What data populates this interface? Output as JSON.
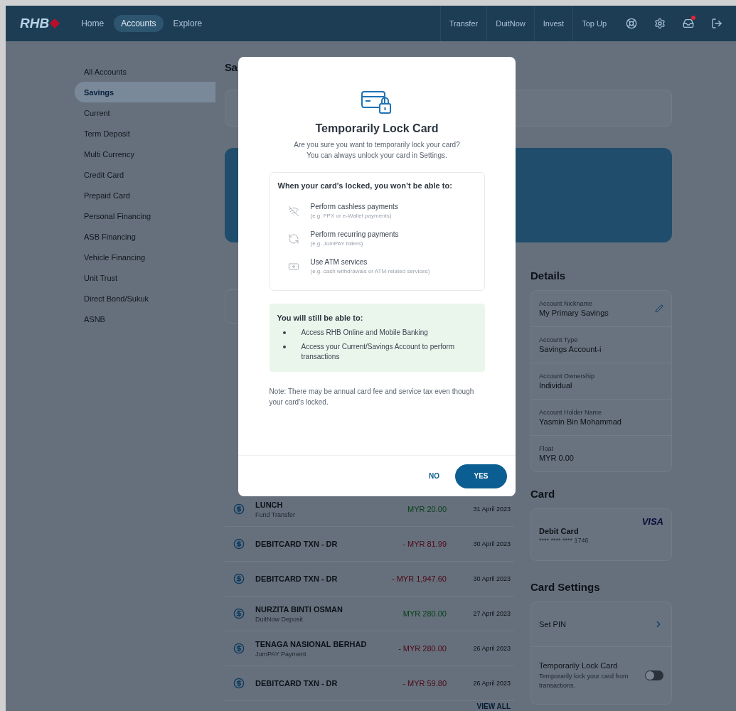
{
  "nav": {
    "logo": "RHB",
    "tabs": [
      {
        "label": "Home",
        "selected": false
      },
      {
        "label": "Accounts",
        "selected": true
      },
      {
        "label": "Explore",
        "selected": false
      }
    ],
    "actions": [
      "Transfer",
      "DuitNow",
      "Invest",
      "Top Up"
    ],
    "inbox_unread": true
  },
  "sidebar": {
    "items": [
      {
        "label": "All Accounts",
        "selected": false
      },
      {
        "label": "Savings",
        "selected": true
      },
      {
        "label": "Current",
        "selected": false
      },
      {
        "label": "Term Deposit",
        "selected": false
      },
      {
        "label": "Multi Currency",
        "selected": false
      },
      {
        "label": "Credit Card",
        "selected": false
      },
      {
        "label": "Prepaid Card",
        "selected": false
      },
      {
        "label": "Personal Financing",
        "selected": false
      },
      {
        "label": "ASB Financing",
        "selected": false
      },
      {
        "label": "Vehicle Financing",
        "selected": false
      },
      {
        "label": "Unit Trust",
        "selected": false
      },
      {
        "label": "Direct Bond/Sukuk",
        "selected": false
      },
      {
        "label": "ASNB",
        "selected": false
      }
    ]
  },
  "page_title": "Sa",
  "transactions": {
    "rows": [
      {
        "name": "LUNCH",
        "subtitle": "Fund Transfer",
        "amount": "MYR 20.00",
        "kind": "credit",
        "date": "31 April 2023"
      },
      {
        "name": "DEBITCARD TXN - DR",
        "amount": "- MYR 81.99",
        "kind": "debit",
        "date": "30 April 2023"
      },
      {
        "name": "DEBITCARD TXN - DR",
        "amount": "- MYR 1,947.60",
        "kind": "debit",
        "date": "30 April 2023"
      },
      {
        "name": "NURZITA BINTI OSMAN",
        "subtitle": "DuitNow Deposit",
        "amount": "MYR 280.00",
        "kind": "credit",
        "date": "27 April 2023"
      },
      {
        "name": "TENAGA NASIONAL BERHAD",
        "subtitle": "JomPAY Payment",
        "amount": "- MYR 280.00",
        "kind": "debit",
        "date": "26 April 2023"
      },
      {
        "name": "DEBITCARD TXN - DR",
        "amount": "- MYR 59.80",
        "kind": "debit",
        "date": "26 April 2023"
      }
    ],
    "view_all": "VIEW ALL"
  },
  "details": {
    "title": "Details",
    "fields": [
      {
        "label": "Account Nickname",
        "value": "My Primary Savings",
        "editable": true
      },
      {
        "label": "Account Type",
        "value": "Savings Account-i",
        "editable": false
      },
      {
        "label": "Account Ownership",
        "value": "Individual",
        "editable": false
      },
      {
        "label": "Account Holder Name",
        "value": "Yasmin Bin Mohammad",
        "editable": false
      },
      {
        "label": "Float",
        "value": "MYR 0.00",
        "editable": false
      }
    ]
  },
  "card": {
    "title": "Card",
    "name": "Debit Card",
    "number": "**** **** **** 1746",
    "network": "VISA"
  },
  "card_settings": {
    "title": "Card Settings",
    "items": [
      {
        "kind": "link",
        "label": "Set PIN"
      },
      {
        "kind": "toggle",
        "label": "Temporarily Lock Card",
        "description": "Temporarily lock your card from transactions.",
        "on": false
      }
    ]
  },
  "modal": {
    "title": "Temporarily Lock Card",
    "subtitle_lines": [
      "Are you sure you want to temporarily lock your card?",
      "You can always unlock your card in Settings."
    ],
    "restrictions": {
      "heading": "When your card’s locked, you won’t be able to:",
      "items": [
        {
          "kind": "cashless",
          "title": "Perform cashless payments",
          "hint": "(e.g. FPX or e-Wallet payments)"
        },
        {
          "kind": "recurring",
          "title": "Perform recurring payments",
          "hint": "(e.g. JomPAY billers)"
        },
        {
          "kind": "atm",
          "title": "Use ATM services",
          "hint": "(e.g. cash withdrawals or ATM-related services)"
        }
      ]
    },
    "allowed": {
      "heading": "You will still be able to:",
      "items": [
        "Access RHB Online and Mobile Banking",
        "Access your Current/Savings Account to perform transactions"
      ]
    },
    "note": "Note: There may be annual card fee and service tax even though your card’s locked.",
    "buttons": {
      "cancel": "NO",
      "confirm": "YES"
    }
  }
}
